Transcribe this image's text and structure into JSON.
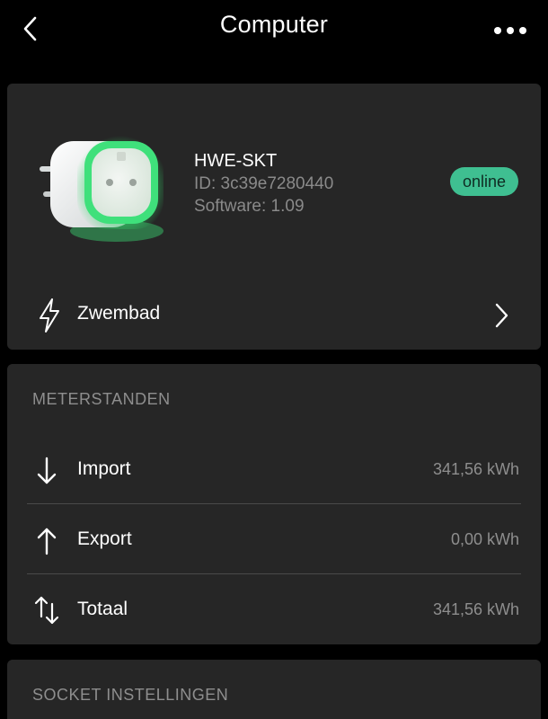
{
  "header": {
    "title": "Computer",
    "back_icon": "chevron-left-icon",
    "more_icon": "more-dots-icon"
  },
  "device": {
    "name": "HWE-SKT",
    "id_text": "ID: 3c39e7280440",
    "software_text": "Software: 1.09",
    "status": "online",
    "status_color": "#3fbf91",
    "image": "smart-plug-image",
    "link": {
      "label": "Zwembad",
      "icon": "lightning-bolt-icon",
      "chevron": "chevron-right-icon"
    }
  },
  "meter": {
    "title": "METERSTANDEN",
    "rows": [
      {
        "icon": "arrow-down-icon",
        "label": "Import",
        "value": "341,56 kWh"
      },
      {
        "icon": "arrow-up-icon",
        "label": "Export",
        "value": "0,00 kWh"
      },
      {
        "icon": "arrows-up-down-icon",
        "label": "Totaal",
        "value": "341,56 kWh"
      }
    ]
  },
  "socket": {
    "title": "SOCKET INSTELLINGEN"
  }
}
